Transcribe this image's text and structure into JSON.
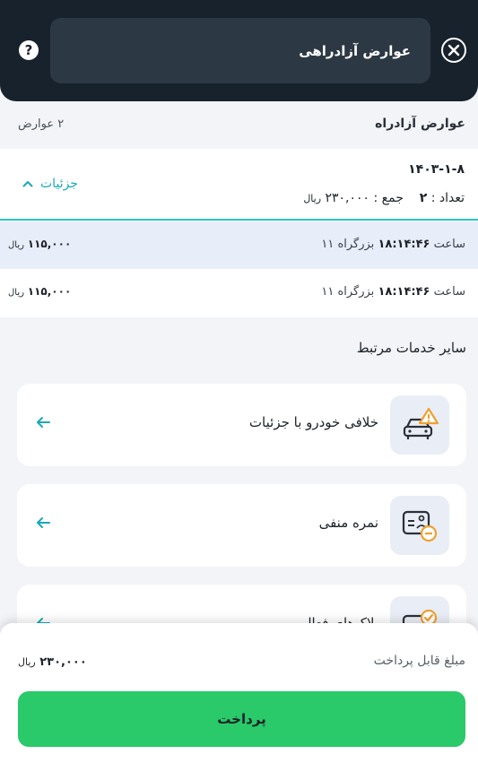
{
  "header": {
    "title": "عوارض آزادراهی",
    "help_label": "?"
  },
  "summary": {
    "title": "عوارض آزادراه",
    "count": "۲ عوارض"
  },
  "detail": {
    "date": "۱۴۰۳-۱-۸",
    "count_label": "تعداد :",
    "count_value": "۲",
    "sum_label": "جمع :",
    "sum_value": "۲۳۰,۰۰۰",
    "currency": "ریال",
    "toggle_label": "جزئیات"
  },
  "items": [
    {
      "time_prefix": "ساعت",
      "time": "۱۸:۱۴:۴۶",
      "road": "بزرگراه ۱۱",
      "amount": "۱۱۵,۰۰۰",
      "currency": "ریال"
    },
    {
      "time_prefix": "ساعت",
      "time": "۱۸:۱۴:۴۶",
      "road": "بزرگراه ۱۱",
      "amount": "۱۱۵,۰۰۰",
      "currency": "ریال"
    }
  ],
  "related": {
    "title": "سایر خدمات مرتبط",
    "services": [
      {
        "label": "خلافی خودرو با جزئیات",
        "icon": "car-warning-icon"
      },
      {
        "label": "نمره منفی",
        "icon": "license-minus-icon"
      },
      {
        "label": "پلاک‌های فعال",
        "icon": "plate-check-icon"
      }
    ]
  },
  "payment": {
    "label": "مبلغ قابل پرداخت",
    "amount": "۲۳۰,۰۰۰",
    "currency": "ریال",
    "button_label": "پرداخت"
  },
  "colors": {
    "header_bg": "#18222c",
    "accent_teal": "#18a9b8",
    "pay_green": "#2ac96a",
    "warning_orange": "#f0a030"
  }
}
